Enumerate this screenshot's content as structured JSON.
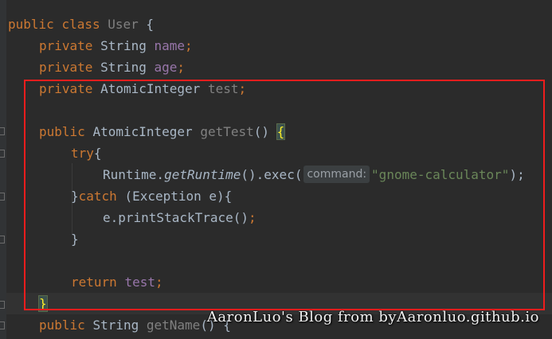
{
  "code": {
    "l1": {
      "kw1": "public",
      "kw2": "class",
      "cls": "User",
      "punc": "{"
    },
    "l2": {
      "kw": "private",
      "type": "String",
      "name": "name",
      "semi": ";"
    },
    "l3": {
      "kw": "private",
      "type": "String",
      "name": "age",
      "semi": ";"
    },
    "l4": {
      "kw": "private",
      "type": "AtomicInteger",
      "name": "test",
      "semi": ";"
    },
    "l6": {
      "kw": "public",
      "type": "AtomicInteger",
      "method": "getTest",
      "parens": "()",
      "brace": "{"
    },
    "l7": {
      "kw": "try",
      "brace": "{"
    },
    "l8": {
      "obj": "Runtime.",
      "call": "getRuntime",
      "rest": "().exec(",
      "hint": "command:",
      "str": "\"gnome-calculator\"",
      "end": ");"
    },
    "l9": {
      "close": "}",
      "kw": "catch",
      "rest": " (Exception e){"
    },
    "l10": {
      "text": "e.printStackTrace",
      "rest": "()",
      "semi": ";"
    },
    "l11": {
      "close": "}"
    },
    "l13": {
      "kw": "return",
      "name": "test",
      "semi": ";"
    },
    "l14": {
      "close": "}"
    },
    "l15": {
      "kw": "public",
      "type": "String",
      "method": "getName",
      "rest": "() {"
    }
  },
  "watermark": "AaronLuo's Blog from byAaronluo.github.io",
  "colors": {
    "background": "#2b2b2b",
    "keyword": "#cc7832",
    "field": "#9876aa",
    "string": "#6a8759",
    "text": "#a9b7c6",
    "highlight_box": "#ee1d1d"
  }
}
